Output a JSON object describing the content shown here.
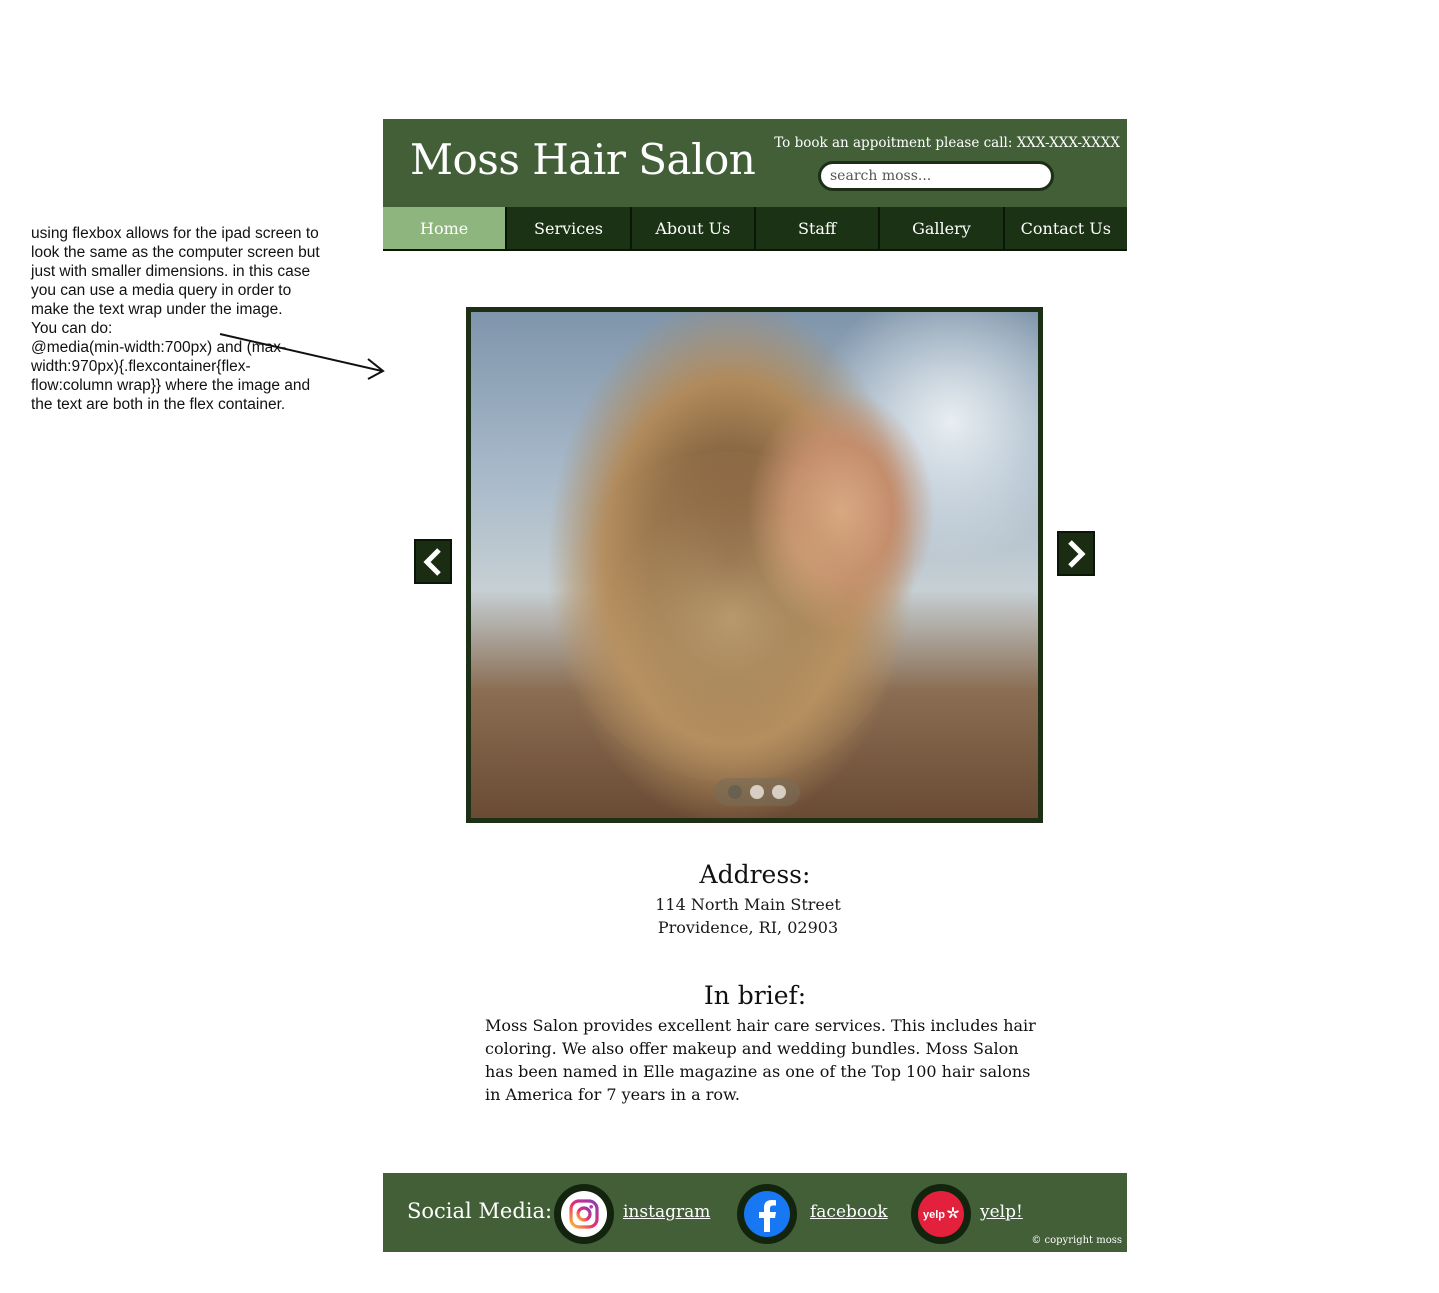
{
  "annotation": {
    "lines": [
      "using flexbox allows for the ipad screen to look the same as the computer screen but just with smaller dimensions. in this case you can use a media query in order to make the text wrap under the image.",
      "You can do:",
      "@media(min-width:700px) and (max-width:970px){.flexcontainer{flex-flow:column wrap}} where the image and the text are both in the flex container."
    ]
  },
  "header": {
    "title": "Moss Hair Salon",
    "booking": "To book an appoitment please call: XXX-XXX-XXXX",
    "search_placeholder": "search moss..."
  },
  "nav": {
    "items": [
      "Home",
      "Services",
      "About Us",
      "Staff",
      "Gallery",
      "Contact Us"
    ],
    "active": "Home"
  },
  "address": {
    "heading": "Address:",
    "line1": "114 North Main Street",
    "line2": "Providence, RI, 02903"
  },
  "brief": {
    "heading": "In brief:",
    "text": "Moss Salon provides excellent hair care services. This includes hair coloring. We also offer makeup and wedding bundles. Moss Salon has been named in Elle magazine as one of the Top 100 hair salons in America for 7 years in a row."
  },
  "footer": {
    "label": "Social Media:",
    "links": [
      {
        "name": "instagram",
        "icon": "instagram-icon"
      },
      {
        "name": "facebook",
        "icon": "facebook-icon"
      },
      {
        "name": "yelp!",
        "icon": "yelp-icon"
      }
    ],
    "copyright": "© copyright moss"
  },
  "colors": {
    "header_green": "#425f38",
    "nav_dark": "#1b3214",
    "nav_active": "#8db57d"
  }
}
